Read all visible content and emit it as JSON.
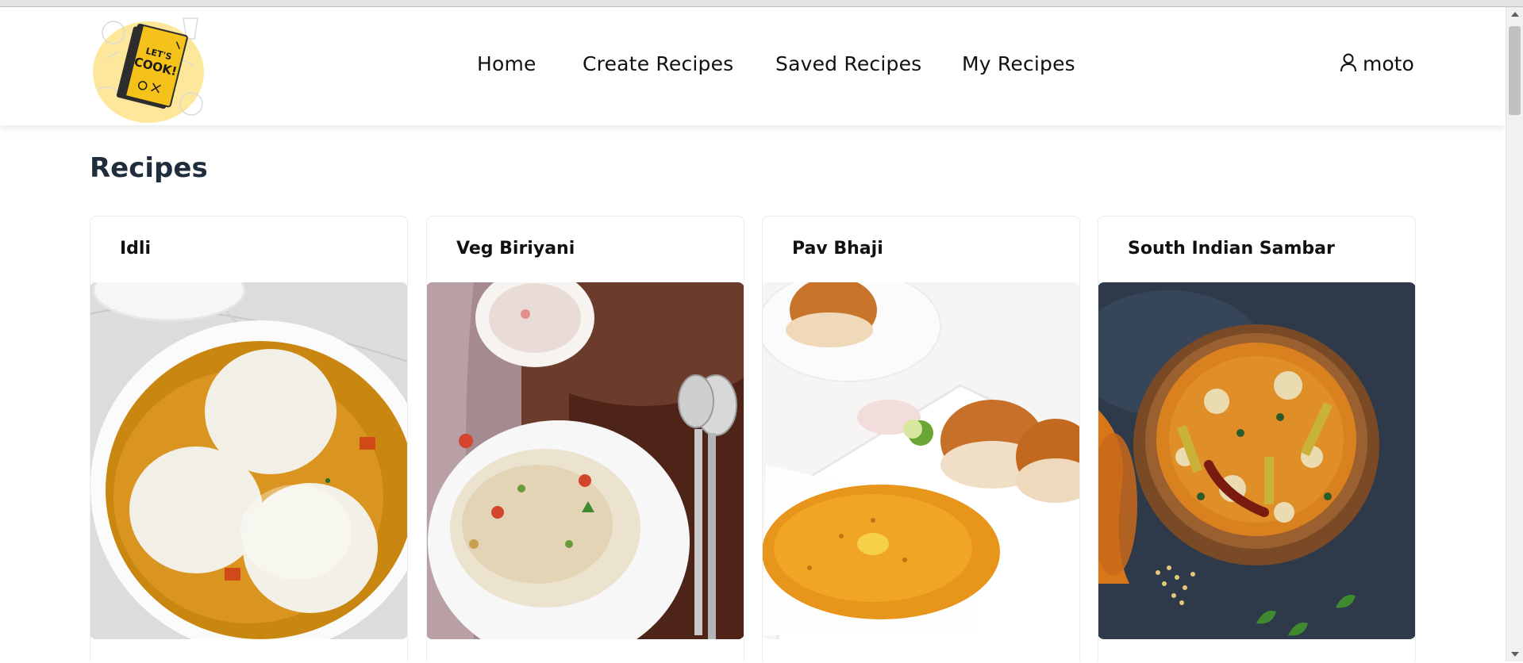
{
  "header": {
    "logo": {
      "icon": "lets-cook-logo",
      "text_line1": "LET'S",
      "text_line2": "COOK!"
    },
    "nav": [
      {
        "label": "Home"
      },
      {
        "label": "Create Recipes"
      },
      {
        "label": "Saved Recipes"
      },
      {
        "label": "My Recipes"
      }
    ],
    "user": {
      "icon": "user-icon",
      "name": "moto"
    }
  },
  "main": {
    "title": "Recipes",
    "recipes": [
      {
        "name": "Idli",
        "image": "idli-photo"
      },
      {
        "name": "Veg Biriyani",
        "image": "veg-biriyani-photo"
      },
      {
        "name": "Pav Bhaji",
        "image": "pav-bhaji-photo"
      },
      {
        "name": "South Indian Sambar",
        "image": "sambar-photo"
      }
    ]
  },
  "colors": {
    "title": "#1f2d3d",
    "logo_circle": "#fde79a",
    "book": "#f5c21b"
  }
}
